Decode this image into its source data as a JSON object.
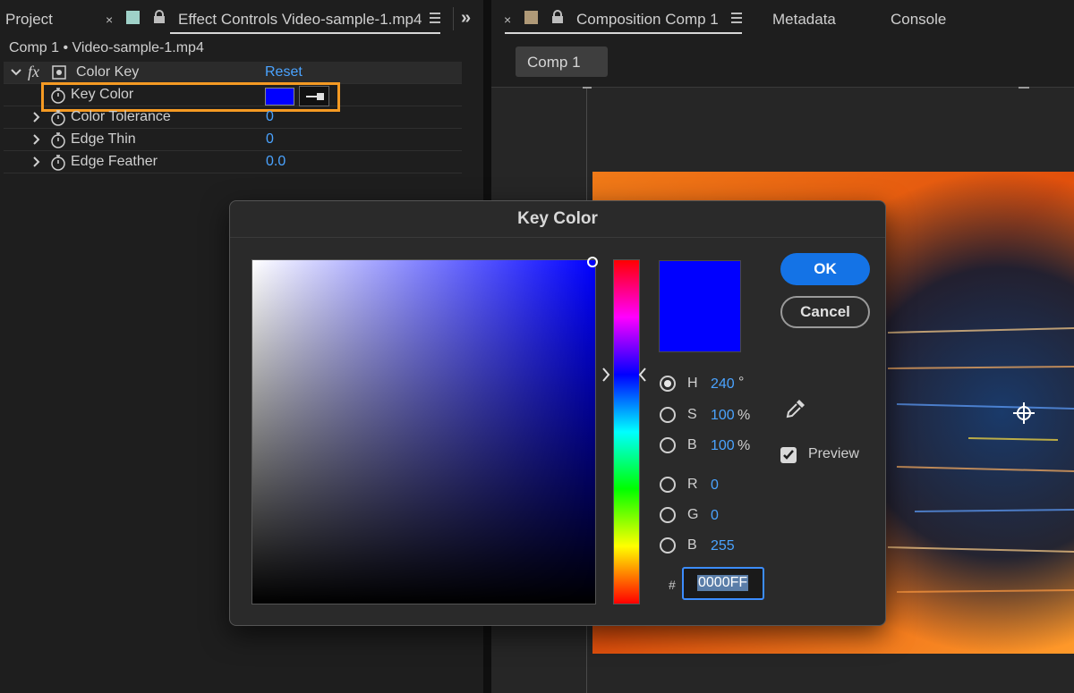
{
  "left_panel": {
    "tabs": {
      "project": "Project",
      "close": "×",
      "effect_controls": "Effect Controls Video-sample-1.mp4",
      "overflow": "»"
    },
    "subtitle": "Comp 1 • Video-sample-1.mp4",
    "effect": {
      "fx": "fx",
      "name": "Color Key",
      "reset": "Reset",
      "params": [
        {
          "label": "Key Color",
          "value": ""
        },
        {
          "label": "Color Tolerance",
          "value": "0"
        },
        {
          "label": "Edge Thin",
          "value": "0"
        },
        {
          "label": "Edge Feather",
          "value": "0.0"
        }
      ],
      "key_color_hex": "#0000FF"
    }
  },
  "right_panel": {
    "tabs": {
      "close": "×",
      "composition": "Composition Comp 1",
      "metadata": "Metadata",
      "console": "Console"
    },
    "sub_tab": "Comp 1"
  },
  "dialog": {
    "title": "Key Color",
    "ok_label": "OK",
    "cancel_label": "Cancel",
    "preview_label": "Preview",
    "preview_checked": true,
    "fields": {
      "h": {
        "label": "H",
        "value": "240",
        "unit": "°"
      },
      "s": {
        "label": "S",
        "value": "100",
        "unit": "%"
      },
      "b": {
        "label": "B",
        "value": "100",
        "unit": "%"
      },
      "r": {
        "label": "R",
        "value": "0"
      },
      "g": {
        "label": "G",
        "value": "0"
      },
      "b2": {
        "label": "B",
        "value": "255"
      }
    },
    "hash": "#",
    "hex_value": "0000FF",
    "selected_color": "#0000FF"
  },
  "colors": {
    "accent_blue": "#1473e6",
    "value_blue": "#4aa3ff",
    "highlight_orange": "#f59a23"
  }
}
